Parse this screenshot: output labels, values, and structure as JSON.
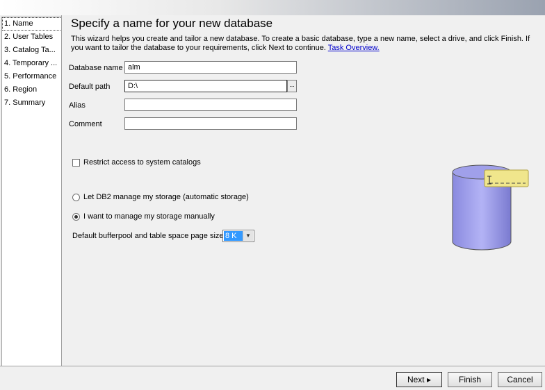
{
  "nav": {
    "items": [
      {
        "label": "1. Name",
        "selected": true
      },
      {
        "label": "2. User Tables",
        "selected": false
      },
      {
        "label": "3. Catalog Ta...",
        "selected": false
      },
      {
        "label": "4. Temporary ...",
        "selected": false
      },
      {
        "label": "5. Performance",
        "selected": false
      },
      {
        "label": "6. Region",
        "selected": false
      },
      {
        "label": "7. Summary",
        "selected": false
      }
    ]
  },
  "page": {
    "title": "Specify a name for your new database",
    "intro": "This wizard helps you create and tailor a new database. To create a basic database, type a new name, select a drive, and click Finish. If you want to tailor the database to your requirements, click Next to continue.",
    "intro_link": "Task Overview."
  },
  "form": {
    "database_name_label": "Database name",
    "database_name_value": "alm",
    "default_path_label": "Default path",
    "default_path_value": "D:\\",
    "browse_label": "...",
    "alias_label": "Alias",
    "alias_value": "",
    "comment_label": "Comment",
    "comment_value": "",
    "restrict_access_label": "Restrict access to system catalogs",
    "restrict_access_checked": false,
    "storage_auto_label": "Let DB2 manage my storage (automatic storage)",
    "storage_manual_label": "I want to manage my storage manually",
    "storage_selected": "manual",
    "page_size_label": "Default bufferpool and table space page size",
    "page_size_value": "8 K"
  },
  "buttons": {
    "next": "Next",
    "finish": "Finish",
    "cancel": "Cancel"
  },
  "icons": {
    "db": "database-cylinder-icon",
    "tag": "name-tag-icon",
    "cursor": "text-cursor-icon"
  },
  "colors": {
    "cylinder": "#9b9bea",
    "tag": "#f0e68c",
    "selection": "#3399ff",
    "link": "#0000cc"
  }
}
